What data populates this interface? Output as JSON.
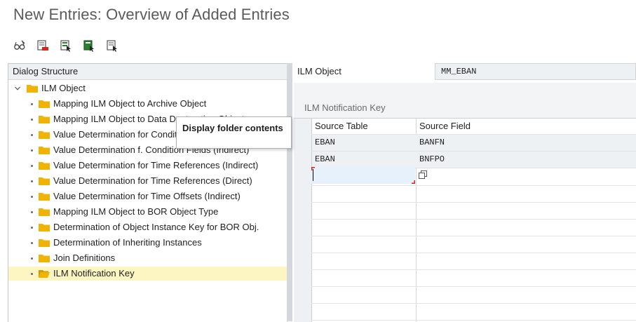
{
  "window": {
    "title": "New Entries: Overview of Added Entries"
  },
  "toolbar": {
    "buttons": [
      {
        "icon": "glasses-icon"
      },
      {
        "icon": "delete-entry-icon"
      },
      {
        "icon": "select-block-icon"
      },
      {
        "icon": "select-all-icon"
      },
      {
        "icon": "deselect-all-icon"
      }
    ]
  },
  "dialog_structure": {
    "header": "Dialog Structure",
    "root": {
      "label": "ILM Object",
      "expanded": true
    },
    "items": [
      {
        "label": "Mapping ILM Object to Archive Object"
      },
      {
        "label": "Mapping ILM Object to Data Destruction Object"
      },
      {
        "label": "Value Determination for Condition Fields (Direct)"
      },
      {
        "label": "Value Determination f. Condition Fields (Indirect)"
      },
      {
        "label": "Value Determination for Time References (Indirect)"
      },
      {
        "label": "Value Determination for Time References (Direct)"
      },
      {
        "label": "Value Determination for Time Offsets (Indirect)"
      },
      {
        "label": "Mapping ILM Object to BOR Object Type"
      },
      {
        "label": "Determination of Object Instance Key for BOR Obj."
      },
      {
        "label": "Determination of Inheriting Instances"
      },
      {
        "label": "Join Definitions"
      },
      {
        "label": "ILM Notification Key",
        "selected": true
      }
    ],
    "tooltip": "Display folder contents"
  },
  "detail": {
    "ilm_object_label": "ILM Object",
    "ilm_object_value": "MM_EBAN",
    "group_title": "ILM Notification Key",
    "columns": [
      "Source Table",
      "Source Field"
    ],
    "rows": [
      [
        "EBAN",
        "BANFN"
      ],
      [
        "EBAN",
        "BNFPO"
      ]
    ],
    "new_row": {
      "source_table": "",
      "source_field": ""
    }
  },
  "colors": {
    "folder": "#f0b400",
    "selected_row": "#fdf6c3",
    "error_marker": "#d9261c"
  }
}
